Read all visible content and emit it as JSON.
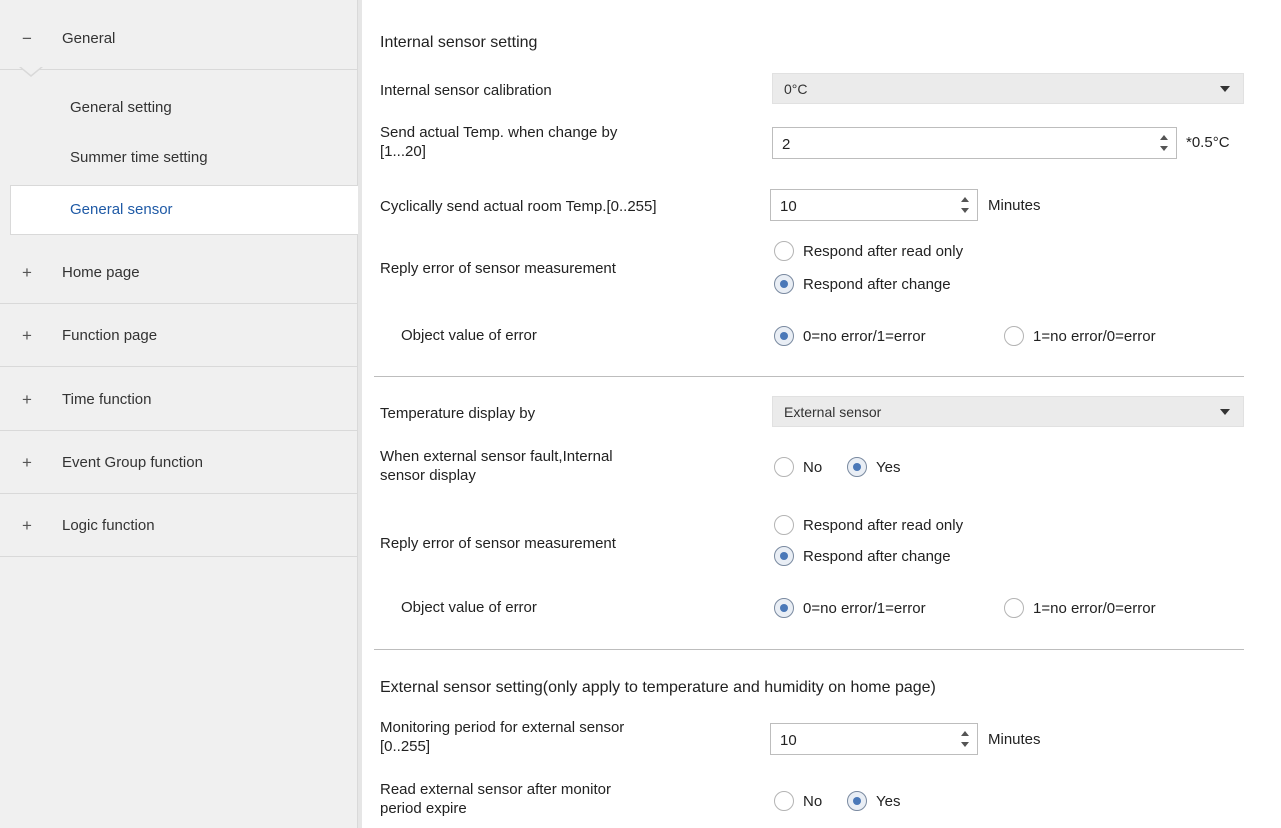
{
  "sidebar": {
    "general": {
      "sign": "−",
      "label": "General"
    },
    "sub_items": [
      "General setting",
      "Summer time setting"
    ],
    "active_item": "General sensor",
    "groups": [
      {
        "sign": "+",
        "label": "Home page"
      },
      {
        "sign": "+",
        "label": "Function page"
      },
      {
        "sign": "+",
        "label": "Time function"
      },
      {
        "sign": "+",
        "label": "Event Group function"
      },
      {
        "sign": "+",
        "label": "Logic function"
      }
    ]
  },
  "internal": {
    "title": "Internal sensor setting",
    "calibration": {
      "label": "Internal sensor calibration",
      "value": "0°C"
    },
    "send_change": {
      "label_1": "Send actual Temp. when change by",
      "label_2": "[1...20]",
      "value": "2",
      "unit": "*0.5°C"
    },
    "cyclic": {
      "label": "Cyclically send actual room Temp.[0..255]",
      "value": "10",
      "unit": "Minutes"
    },
    "reply_error": {
      "label": "Reply error of sensor measurement",
      "option_1": "Respond after read only",
      "option_2": "Respond after change",
      "selected": 2
    },
    "object_value": {
      "label": "Object value of error",
      "option_1": "0=no error/1=error",
      "option_2": "1=no error/0=error",
      "selected": 1
    }
  },
  "display": {
    "temp_display": {
      "label": "Temperature display by",
      "value": "External sensor"
    },
    "fault_display": {
      "label_1": "When external sensor fault,Internal",
      "label_2": "sensor display",
      "option_1": "No",
      "option_2": "Yes",
      "selected": 2
    },
    "reply_error": {
      "label": "Reply error of sensor measurement",
      "option_1": "Respond after read only",
      "option_2": "Respond after change",
      "selected": 2
    },
    "object_value": {
      "label": "Object value of error",
      "option_1": "0=no error/1=error",
      "option_2": "1=no error/0=error",
      "selected": 1
    }
  },
  "external": {
    "title": "External sensor setting(only apply to temperature and humidity on home page)",
    "monitoring": {
      "label_1": "Monitoring period for external sensor",
      "label_2": "[0..255]",
      "value": "10",
      "unit": "Minutes"
    },
    "read_after": {
      "label_1": "Read external sensor after monitor",
      "label_2": "period expire",
      "option_1": "No",
      "option_2": "Yes",
      "selected": 2
    }
  }
}
